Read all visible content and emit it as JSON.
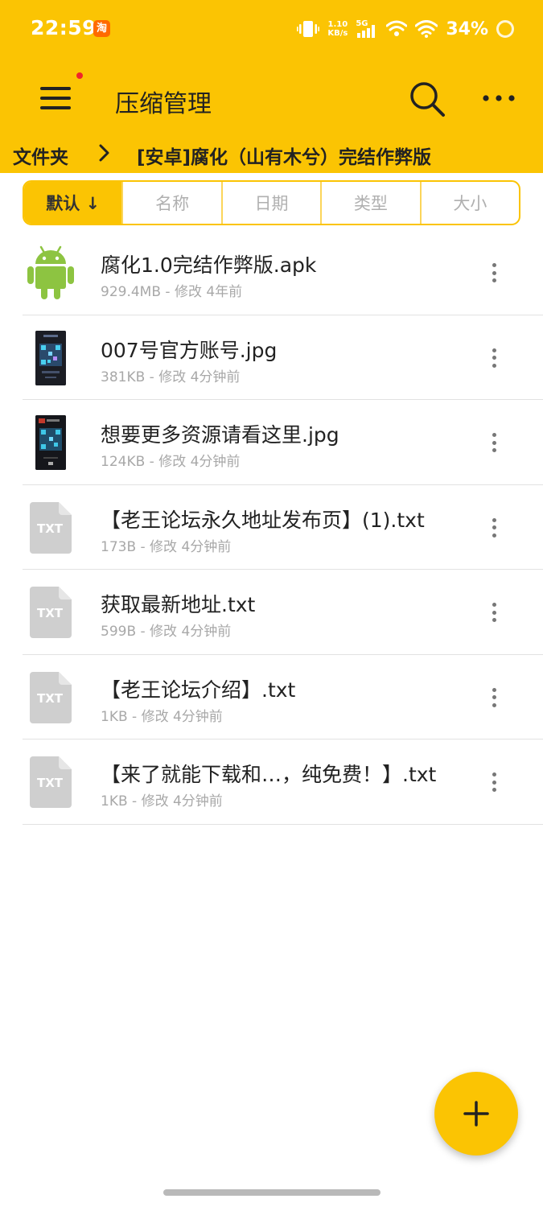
{
  "status_bar": {
    "time": "22:59",
    "notification_badge": "淘",
    "net_speed_value": "1.10",
    "net_speed_unit": "KB/s",
    "network_type": "5G",
    "battery_percent": "34%"
  },
  "app_bar": {
    "title": "压缩管理"
  },
  "breadcrumb": {
    "parent": "文件夹",
    "current": "[安卓]腐化（山有木兮）完结作弊版"
  },
  "sort_tabs": [
    {
      "label": "默认 ↓",
      "active": true
    },
    {
      "label": "名称",
      "active": false
    },
    {
      "label": "日期",
      "active": false
    },
    {
      "label": "类型",
      "active": false
    },
    {
      "label": "大小",
      "active": false
    }
  ],
  "files": [
    {
      "name": "腐化1.0完结作弊版.apk",
      "meta": "929.4MB - 修改 4年前",
      "icon": "android-icon"
    },
    {
      "name": "007号官方账号.jpg",
      "meta": "381KB - 修改 4分钟前",
      "icon": "image-thumbnail"
    },
    {
      "name": "想要更多资源请看这里.jpg",
      "meta": "124KB - 修改 4分钟前",
      "icon": "image-thumbnail"
    },
    {
      "name": "【老王论坛永久地址发布页】(1).txt",
      "meta": "173B - 修改 4分钟前",
      "icon": "txt-file-icon",
      "icon_label": "TXT"
    },
    {
      "name": "获取最新地址.txt",
      "meta": "599B - 修改 4分钟前",
      "icon": "txt-file-icon",
      "icon_label": "TXT"
    },
    {
      "name": "【老王论坛介绍】.txt",
      "meta": "1KB - 修改 4分钟前",
      "icon": "txt-file-icon",
      "icon_label": "TXT"
    },
    {
      "name": "【来了就能下载和…，纯免费！】.txt",
      "meta": "1KB - 修改 4分钟前",
      "icon": "txt-file-icon",
      "icon_label": "TXT"
    }
  ],
  "colors": {
    "accent": "#fbc403",
    "android_green": "#8dc441",
    "file_icon_gray": "#cfcfcf"
  }
}
